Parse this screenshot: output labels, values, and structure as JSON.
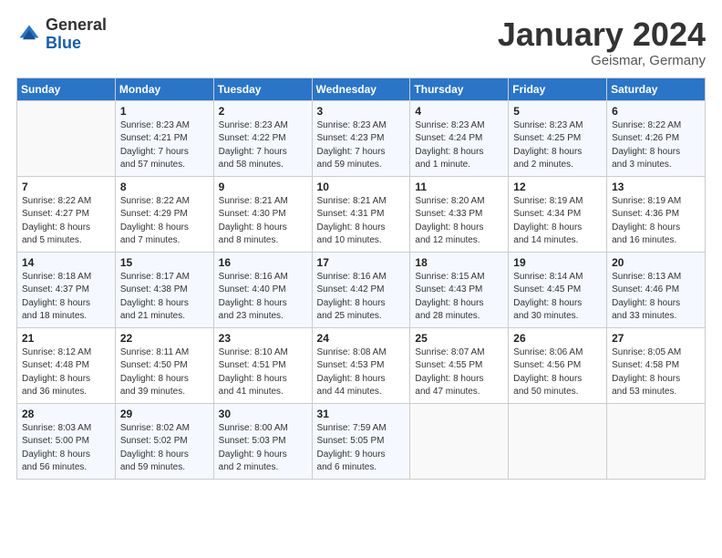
{
  "logo": {
    "general": "General",
    "blue": "Blue"
  },
  "title": "January 2024",
  "location": "Geismar, Germany",
  "days_header": [
    "Sunday",
    "Monday",
    "Tuesday",
    "Wednesday",
    "Thursday",
    "Friday",
    "Saturday"
  ],
  "weeks": [
    [
      {
        "num": "",
        "info": ""
      },
      {
        "num": "1",
        "info": "Sunrise: 8:23 AM\nSunset: 4:21 PM\nDaylight: 7 hours\nand 57 minutes."
      },
      {
        "num": "2",
        "info": "Sunrise: 8:23 AM\nSunset: 4:22 PM\nDaylight: 7 hours\nand 58 minutes."
      },
      {
        "num": "3",
        "info": "Sunrise: 8:23 AM\nSunset: 4:23 PM\nDaylight: 7 hours\nand 59 minutes."
      },
      {
        "num": "4",
        "info": "Sunrise: 8:23 AM\nSunset: 4:24 PM\nDaylight: 8 hours\nand 1 minute."
      },
      {
        "num": "5",
        "info": "Sunrise: 8:23 AM\nSunset: 4:25 PM\nDaylight: 8 hours\nand 2 minutes."
      },
      {
        "num": "6",
        "info": "Sunrise: 8:22 AM\nSunset: 4:26 PM\nDaylight: 8 hours\nand 3 minutes."
      }
    ],
    [
      {
        "num": "7",
        "info": "Sunrise: 8:22 AM\nSunset: 4:27 PM\nDaylight: 8 hours\nand 5 minutes."
      },
      {
        "num": "8",
        "info": "Sunrise: 8:22 AM\nSunset: 4:29 PM\nDaylight: 8 hours\nand 7 minutes."
      },
      {
        "num": "9",
        "info": "Sunrise: 8:21 AM\nSunset: 4:30 PM\nDaylight: 8 hours\nand 8 minutes."
      },
      {
        "num": "10",
        "info": "Sunrise: 8:21 AM\nSunset: 4:31 PM\nDaylight: 8 hours\nand 10 minutes."
      },
      {
        "num": "11",
        "info": "Sunrise: 8:20 AM\nSunset: 4:33 PM\nDaylight: 8 hours\nand 12 minutes."
      },
      {
        "num": "12",
        "info": "Sunrise: 8:19 AM\nSunset: 4:34 PM\nDaylight: 8 hours\nand 14 minutes."
      },
      {
        "num": "13",
        "info": "Sunrise: 8:19 AM\nSunset: 4:36 PM\nDaylight: 8 hours\nand 16 minutes."
      }
    ],
    [
      {
        "num": "14",
        "info": "Sunrise: 8:18 AM\nSunset: 4:37 PM\nDaylight: 8 hours\nand 18 minutes."
      },
      {
        "num": "15",
        "info": "Sunrise: 8:17 AM\nSunset: 4:38 PM\nDaylight: 8 hours\nand 21 minutes."
      },
      {
        "num": "16",
        "info": "Sunrise: 8:16 AM\nSunset: 4:40 PM\nDaylight: 8 hours\nand 23 minutes."
      },
      {
        "num": "17",
        "info": "Sunrise: 8:16 AM\nSunset: 4:42 PM\nDaylight: 8 hours\nand 25 minutes."
      },
      {
        "num": "18",
        "info": "Sunrise: 8:15 AM\nSunset: 4:43 PM\nDaylight: 8 hours\nand 28 minutes."
      },
      {
        "num": "19",
        "info": "Sunrise: 8:14 AM\nSunset: 4:45 PM\nDaylight: 8 hours\nand 30 minutes."
      },
      {
        "num": "20",
        "info": "Sunrise: 8:13 AM\nSunset: 4:46 PM\nDaylight: 8 hours\nand 33 minutes."
      }
    ],
    [
      {
        "num": "21",
        "info": "Sunrise: 8:12 AM\nSunset: 4:48 PM\nDaylight: 8 hours\nand 36 minutes."
      },
      {
        "num": "22",
        "info": "Sunrise: 8:11 AM\nSunset: 4:50 PM\nDaylight: 8 hours\nand 39 minutes."
      },
      {
        "num": "23",
        "info": "Sunrise: 8:10 AM\nSunset: 4:51 PM\nDaylight: 8 hours\nand 41 minutes."
      },
      {
        "num": "24",
        "info": "Sunrise: 8:08 AM\nSunset: 4:53 PM\nDaylight: 8 hours\nand 44 minutes."
      },
      {
        "num": "25",
        "info": "Sunrise: 8:07 AM\nSunset: 4:55 PM\nDaylight: 8 hours\nand 47 minutes."
      },
      {
        "num": "26",
        "info": "Sunrise: 8:06 AM\nSunset: 4:56 PM\nDaylight: 8 hours\nand 50 minutes."
      },
      {
        "num": "27",
        "info": "Sunrise: 8:05 AM\nSunset: 4:58 PM\nDaylight: 8 hours\nand 53 minutes."
      }
    ],
    [
      {
        "num": "28",
        "info": "Sunrise: 8:03 AM\nSunset: 5:00 PM\nDaylight: 8 hours\nand 56 minutes."
      },
      {
        "num": "29",
        "info": "Sunrise: 8:02 AM\nSunset: 5:02 PM\nDaylight: 8 hours\nand 59 minutes."
      },
      {
        "num": "30",
        "info": "Sunrise: 8:00 AM\nSunset: 5:03 PM\nDaylight: 9 hours\nand 2 minutes."
      },
      {
        "num": "31",
        "info": "Sunrise: 7:59 AM\nSunset: 5:05 PM\nDaylight: 9 hours\nand 6 minutes."
      },
      {
        "num": "",
        "info": ""
      },
      {
        "num": "",
        "info": ""
      },
      {
        "num": "",
        "info": ""
      }
    ]
  ]
}
